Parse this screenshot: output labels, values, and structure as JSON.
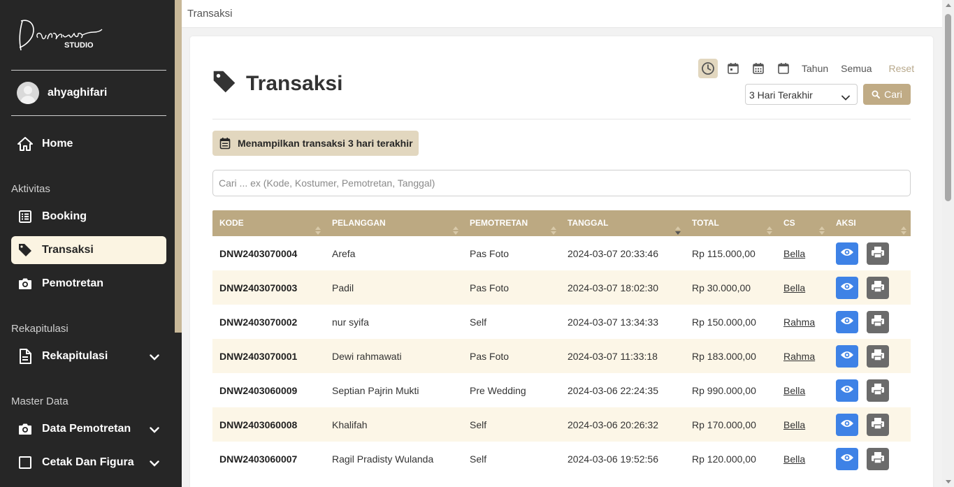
{
  "brand": {
    "logo_script": "Danawa",
    "logo_sub": "STUDIO"
  },
  "user": {
    "name": "ahyaghifari"
  },
  "nav": {
    "home": "Home",
    "section_aktivitas": "Aktivitas",
    "booking": "Booking",
    "transaksi": "Transaksi",
    "pemotretan": "Pemotretan",
    "section_rekap": "Rekapitulasi",
    "rekapitulasi": "Rekapitulasi",
    "section_master": "Master Data",
    "data_pemotretan": "Data Pemotretan",
    "cetak_figura": "Cetak Dan Figura"
  },
  "topbar": {
    "title": "Transaksi"
  },
  "page": {
    "title": "Transaksi"
  },
  "filters": {
    "tahun": "Tahun",
    "semua": "Semua",
    "reset": "Reset",
    "range_selected": "3 Hari Terakhir",
    "search_button": "Cari"
  },
  "notice": "Menampilkan transaksi 3 hari terakhir",
  "search": {
    "placeholder": "Cari ... ex (Kode, Kostumer, Pemotretan, Tanggal)"
  },
  "table": {
    "headers": [
      "KODE",
      "PELANGGAN",
      "PEMOTRETAN",
      "TANGGAL",
      "TOTAL",
      "CS",
      "AKSI"
    ],
    "rows": [
      [
        "DNW2403070004",
        "Arefa",
        "Pas Foto",
        "2024-03-07 20:33:46",
        "Rp 115.000,00",
        "Bella"
      ],
      [
        "DNW2403070003",
        "Padil",
        "Pas Foto",
        "2024-03-07 18:02:30",
        "Rp 30.000,00",
        "Bella"
      ],
      [
        "DNW2403070002",
        "nur syifa",
        "Self",
        "2024-03-07 13:34:33",
        "Rp 150.000,00",
        "Rahma"
      ],
      [
        "DNW2403070001",
        "Dewi rahmawati",
        "Pas Foto",
        "2024-03-07 11:33:18",
        "Rp 183.000,00",
        "Rahma"
      ],
      [
        "DNW2403060009",
        "Septian Pajrin Mukti",
        "Pre Wedding",
        "2024-03-06 22:24:35",
        "Rp 990.000,00",
        "Bella"
      ],
      [
        "DNW2403060008",
        "Khalifah",
        "Self",
        "2024-03-06 20:26:32",
        "Rp 170.000,00",
        "Bella"
      ],
      [
        "DNW2403060007",
        "Ragil Pradisty Wulanda",
        "Self",
        "2024-03-06 19:52:56",
        "Rp 120.000,00",
        "Bella"
      ]
    ]
  },
  "colors": {
    "sidebar": "#262626",
    "accent": "#bca982",
    "active_nav": "#fbf4e2",
    "view_button": "#3e82e6",
    "print_button": "#6b6b6b"
  }
}
